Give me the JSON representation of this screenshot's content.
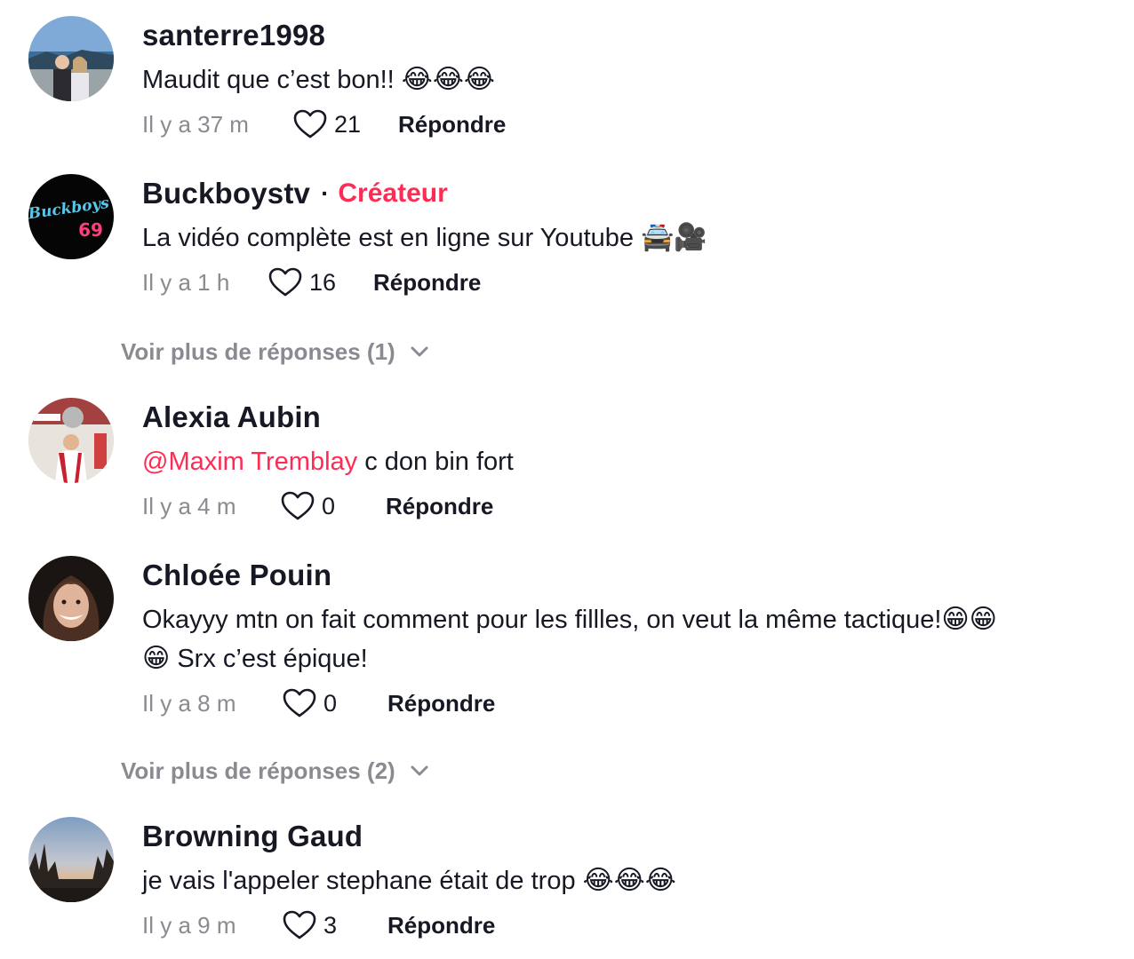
{
  "comments": [
    {
      "username": "santerre1998",
      "text": "Maudit que c’est bon!!",
      "emojis": "😂😂😂",
      "time": "Il y a 37 m",
      "likes": "21",
      "reply": "Répondre"
    },
    {
      "username": "Buckboystv",
      "badge": "Créateur",
      "text": "La vidéo complète est en ligne sur Youtube",
      "emojis": "🚔🎥",
      "time": "Il y a 1 h",
      "likes": "16",
      "reply": "Répondre",
      "avatar_text_top": "Buckboys",
      "avatar_text_bottom": "69"
    },
    {
      "username": "Alexia Aubin",
      "mention": "@Maxim Tremblay",
      "text": " c don bin fort",
      "time": "Il y a 4 m",
      "likes": "0",
      "reply": "Répondre"
    },
    {
      "username": "Chloée Pouin",
      "text_line1": "Okayyy mtn on fait comment pour les fillles, on veut la même tactique!",
      "emojis_line1": "😁😁",
      "emoji_line2": "😁",
      "text_line2": " Srx c’est épique!",
      "time": "Il y a 8 m",
      "likes": "0",
      "reply": "Répondre"
    },
    {
      "username": "Browning Gaud",
      "text": "je vais l'appeler stephane était de trop",
      "emojis": "😂😂😂",
      "time": "Il y a 9 m",
      "likes": "3",
      "reply": "Répondre"
    }
  ],
  "view_more": [
    {
      "label": "Voir plus de réponses (1)"
    },
    {
      "label": "Voir plus de réponses (2)"
    }
  ],
  "colors": {
    "accent": "#fe2c55",
    "text": "#161823",
    "muted": "#8a8b91"
  },
  "icons": {
    "like": "heart-outline-icon",
    "expand": "chevron-down-icon"
  }
}
